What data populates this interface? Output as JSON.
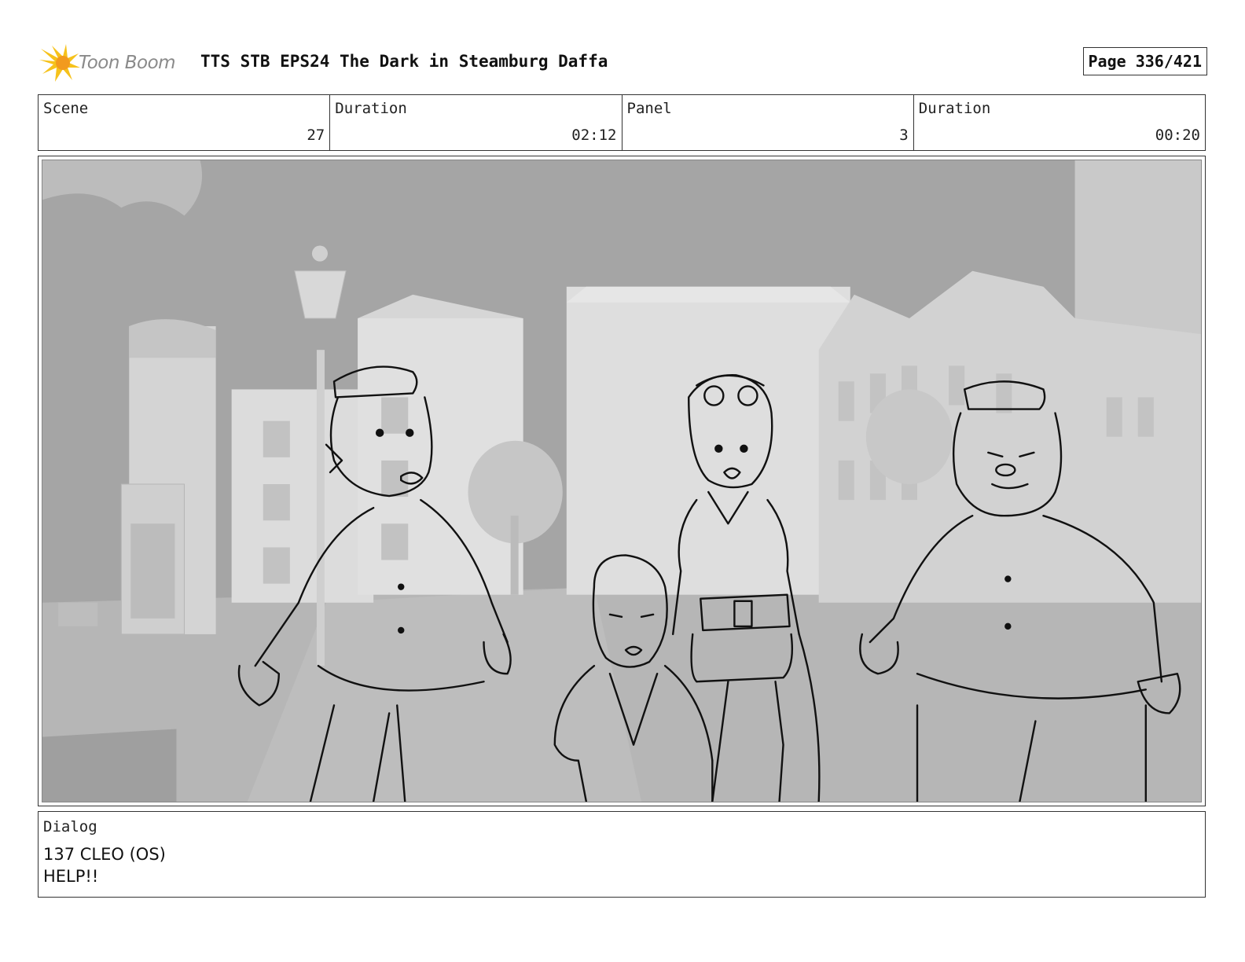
{
  "header": {
    "logo_text": "Toon Boom",
    "title": "TTS STB EPS24 The Dark in Steamburg Daffa",
    "page": "Page 336/421"
  },
  "info": {
    "scene_label": "Scene",
    "scene_value": "27",
    "scene_duration_label": "Duration",
    "scene_duration_value": "02:12",
    "panel_label": "Panel",
    "panel_value": "3",
    "panel_duration_label": "Duration",
    "panel_duration_value": "00:20"
  },
  "dialog": {
    "label": "Dialog",
    "lines": [
      "137 CLEO (OS)",
      "HELP!!"
    ]
  },
  "colors": {
    "logo_yellow": "#f6c21b",
    "logo_orange": "#f29a1e",
    "frame_border": "#333333",
    "sky": "#a5a5a5"
  }
}
